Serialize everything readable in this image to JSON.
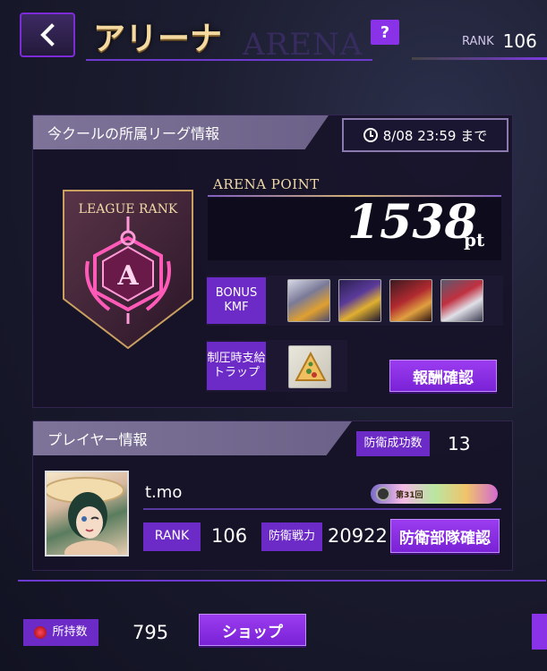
{
  "header": {
    "back_icon": "chevron-left-icon",
    "title_jp": "アリーナ",
    "title_en": "ARENA",
    "help_label": "?",
    "rank_label": "RANK",
    "rank_value": "106"
  },
  "league": {
    "section_title": "今クールの所属リーグ情報",
    "deadline": "8/08 23:59 まで",
    "badge_label": "LEAGUE RANK",
    "badge_letter": "A",
    "arena_point_label": "ARENA POINT",
    "arena_point_value": "1538",
    "arena_point_unit": "pt",
    "bonus_label_line1": "BONUS",
    "bonus_label_line2": "KMF",
    "trap_label_line1": "制圧時支給",
    "trap_label_line2": "トラップ",
    "reward_button": "報酬確認"
  },
  "player": {
    "section_title": "プレイヤー情報",
    "defense_success_label": "防衛成功数",
    "defense_success_value": "13",
    "name": "t.mo",
    "event_badge_text": "第31回",
    "rank_label": "RANK",
    "rank_value": "106",
    "defense_power_label": "防衛戦力",
    "defense_power_value": "20922",
    "defense_team_button": "防衛部隊確認"
  },
  "footer": {
    "owned_label": "所持数",
    "owned_value": "795",
    "shop_button": "ショップ"
  },
  "colors": {
    "accent_purple": "#8a32e8",
    "gold": "#f0d9a8",
    "badge_pink": "#ff3fa0"
  }
}
